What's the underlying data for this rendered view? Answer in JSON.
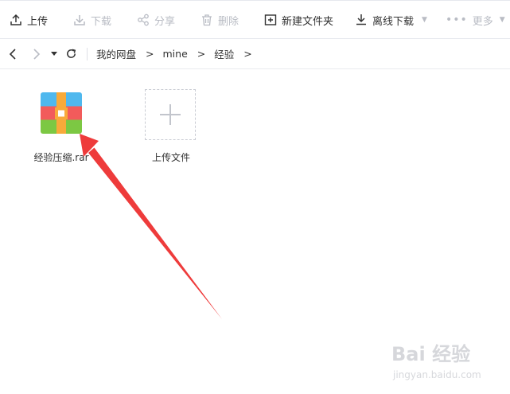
{
  "toolbar": {
    "upload": "上传",
    "download": "下载",
    "share": "分享",
    "delete": "删除",
    "new_folder": "新建文件夹",
    "offline_download": "离线下载",
    "more": "更多"
  },
  "breadcrumb": {
    "root": "我的网盘",
    "level1": "mine",
    "level2": "经验",
    "sep": ">"
  },
  "files": [
    {
      "name": "经验压缩.rar",
      "icon": "rar-archive-icon"
    }
  ],
  "upload_tile": {
    "label": "上传文件"
  },
  "watermark": {
    "brand": "Bai 经验",
    "url": "jingyan.baidu.com"
  },
  "colors": {
    "arrow": "#ee3b3b",
    "rar_blue": "#4fb8ee",
    "rar_red": "#f25b5b",
    "rar_green": "#7cc843",
    "rar_band": "#f8aa3a",
    "disabled": "#b9bcc4"
  }
}
